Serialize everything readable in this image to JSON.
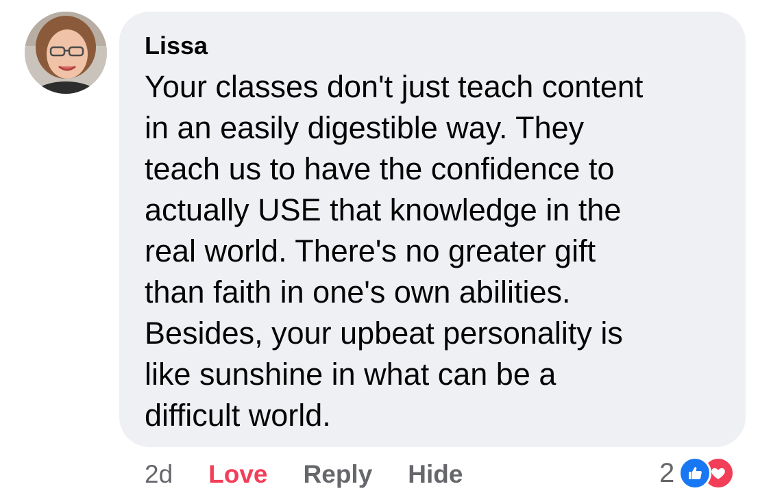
{
  "comment": {
    "author": "Lissa",
    "text_lines": [
      "Your classes don't just teach content",
      "in an easily digestible way. They",
      "teach us to have the confidence to",
      "actually USE that knowledge in the",
      "real world. There's no greater gift",
      "than faith in one's own abilities.",
      "Besides, your upbeat personality is",
      "like sunshine in what can be a",
      "difficult world."
    ]
  },
  "actions": {
    "timestamp": "2d",
    "love_label": "Love",
    "reply_label": "Reply",
    "hide_label": "Hide"
  },
  "reactions": {
    "count": "2",
    "icons": [
      "like-icon",
      "love-icon"
    ]
  },
  "colors": {
    "bubble_bg": "#eff0f4",
    "love": "#f33e58",
    "like": "#1877f2",
    "secondary_text": "#65676b"
  }
}
